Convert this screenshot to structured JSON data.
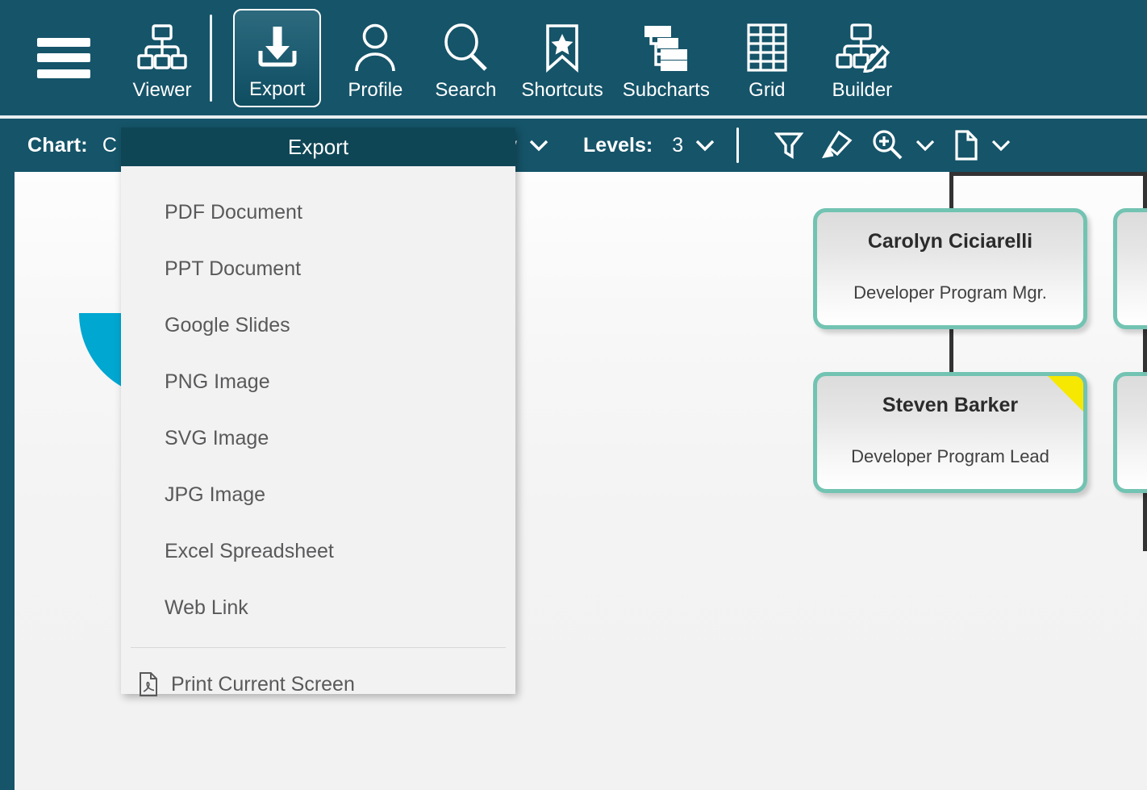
{
  "toolbar": {
    "menu_icon": "hamburger-icon",
    "items": [
      {
        "id": "viewer",
        "label": "Viewer",
        "icon": "org-chart-icon",
        "selected": false
      },
      {
        "id": "export",
        "label": "Export",
        "icon": "download-tray-icon",
        "selected": true
      },
      {
        "id": "profile",
        "label": "Profile",
        "icon": "person-icon",
        "selected": false
      },
      {
        "id": "search",
        "label": "Search",
        "icon": "magnifier-icon",
        "selected": false
      },
      {
        "id": "shortcuts",
        "label": "Shortcuts",
        "icon": "bookmark-star-icon",
        "selected": false
      },
      {
        "id": "subcharts",
        "label": "Subcharts",
        "icon": "subchart-tree-icon",
        "selected": false
      },
      {
        "id": "grid",
        "label": "Grid",
        "icon": "table-grid-icon",
        "selected": false
      },
      {
        "id": "builder",
        "label": "Builder",
        "icon": "chart-pencil-icon",
        "selected": false
      }
    ]
  },
  "subbar": {
    "chart_label": "Chart:",
    "chart_value": "C",
    "overlay_label": "Overlay",
    "levels_label": "Levels:",
    "levels_value": "3",
    "icons": [
      {
        "id": "filter",
        "name": "funnel-filter-icon"
      },
      {
        "id": "highlighter",
        "name": "highlighter-pen-icon"
      },
      {
        "id": "zoom",
        "name": "zoom-in-icon"
      },
      {
        "id": "page",
        "name": "document-page-icon"
      }
    ]
  },
  "export_menu": {
    "title": "Export",
    "items": [
      {
        "label": "PDF Document"
      },
      {
        "label": "PPT Document"
      },
      {
        "label": "Google Slides"
      },
      {
        "label": "PNG Image"
      },
      {
        "label": "SVG Image"
      },
      {
        "label": "JPG Image"
      },
      {
        "label": "Excel Spreadsheet"
      },
      {
        "label": "Web Link"
      }
    ],
    "footer_item": {
      "label": "Print Current Screen",
      "icon": "pdf-file-icon"
    }
  },
  "chart": {
    "nodes": [
      {
        "id": "n1",
        "name": "Carolyn Ciciarelli",
        "title": "Developer Program Mgr.",
        "flag": false
      },
      {
        "id": "n2",
        "name": "Steven Barker",
        "title": "Developer Program Lead",
        "flag": true
      }
    ]
  },
  "colors": {
    "toolbar": "#155469",
    "menu_header": "#0f4656",
    "node_border": "#72c3b2",
    "flag": "#f6e800",
    "connector": "#333333",
    "canvas": "#f3f3f3",
    "logo_orange": "#f6a800",
    "logo_green": "#18bd8b",
    "logo_cyan": "#00a7d1"
  }
}
